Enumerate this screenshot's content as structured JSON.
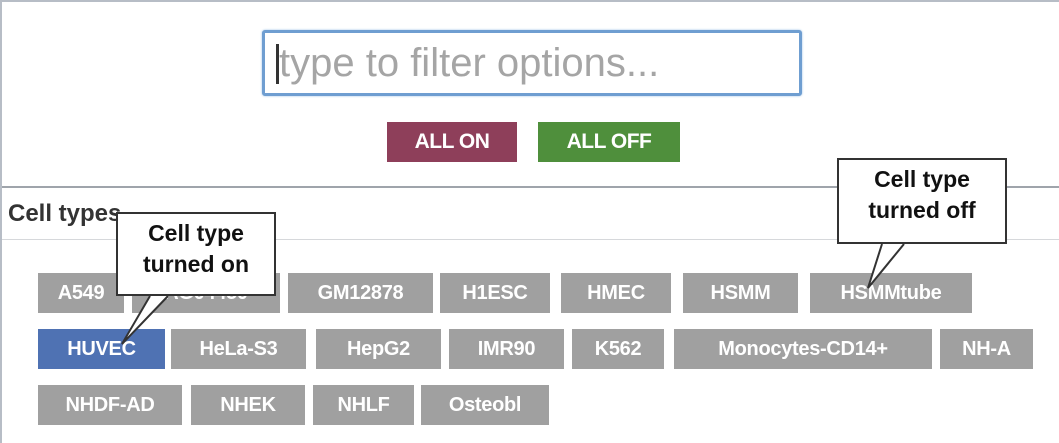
{
  "filter": {
    "placeholder": "type to filter options..."
  },
  "buttons": {
    "all_on": "ALL ON",
    "all_off": "ALL OFF"
  },
  "section": {
    "title": "Cell types"
  },
  "cell_types": [
    {
      "label": "A549",
      "on": false
    },
    {
      "label": "AG04450",
      "on": false
    },
    {
      "label": "GM12878",
      "on": false
    },
    {
      "label": "H1ESC",
      "on": false
    },
    {
      "label": "HMEC",
      "on": false
    },
    {
      "label": "HSMM",
      "on": false
    },
    {
      "label": "HSMMtube",
      "on": false
    },
    {
      "label": "HUVEC",
      "on": true
    },
    {
      "label": "HeLa-S3",
      "on": false
    },
    {
      "label": "HepG2",
      "on": false
    },
    {
      "label": "IMR90",
      "on": false
    },
    {
      "label": "K562",
      "on": false
    },
    {
      "label": "Monocytes-CD14+",
      "on": false
    },
    {
      "label": "NH-A",
      "on": false
    },
    {
      "label": "NHDF-AD",
      "on": false
    },
    {
      "label": "NHEK",
      "on": false
    },
    {
      "label": "NHLF",
      "on": false
    },
    {
      "label": "Osteobl",
      "on": false
    }
  ],
  "callouts": {
    "on": {
      "line1": "Cell type",
      "line2": "turned on"
    },
    "off": {
      "line1": "Cell type",
      "line2": "turned off"
    }
  },
  "colors": {
    "chip_on": "#4f72b3",
    "chip_off": "#a0a0a0",
    "all_on_button": "#8e3f5a",
    "all_off_button": "#4f8f3c",
    "input_border": "#6f9ed1"
  }
}
